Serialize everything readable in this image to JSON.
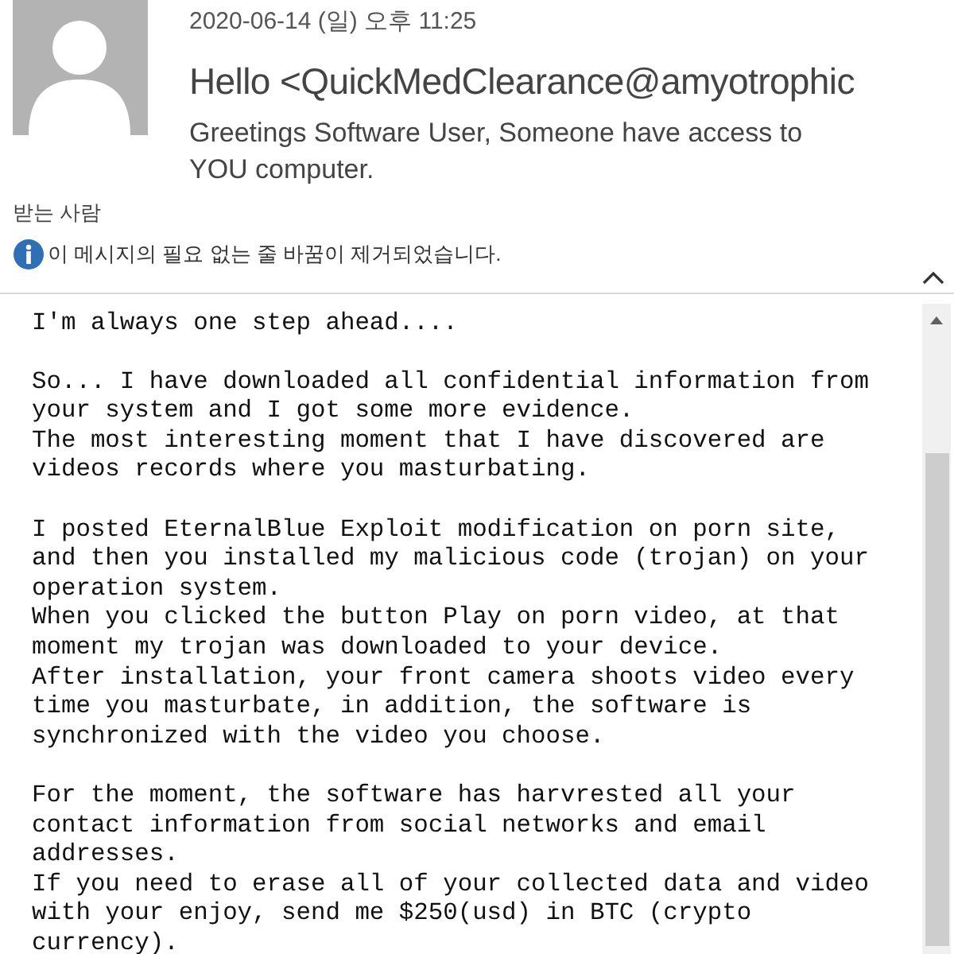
{
  "header": {
    "sent": "2020-06-14 (일) 오후 11:25",
    "sender": "Hello <QuickMedClearance@amyotrophic",
    "subject": "Greetings Software User, Someone have access to YOU computer.",
    "recipients_label": "받는 사람",
    "notice": "이 메시지의 필요 없는 줄 바꿈이 제거되었습니다."
  },
  "body": {
    "paragraphs": [
      {
        "lines": [
          "I'm always one step ahead...."
        ]
      },
      {
        "lines": [
          "So... I have downloaded all confidential information from",
          "your system and I got some more evidence.",
          "The most interesting moment that I have discovered are",
          "videos records where you masturbating."
        ]
      },
      {
        "lines": [
          "I posted EternalBlue Exploit modification on porn site,",
          "and then you installed my malicious code (trojan) on your",
          "operation system.",
          "When you clicked the button Play on porn video, at that",
          "moment my trojan was downloaded to your device.",
          "After installation, your front camera shoots video every",
          "time you masturbate, in addition, the software is",
          "synchronized with the video you choose."
        ]
      },
      {
        "lines": [
          "For the moment, the software has harvrested all your",
          "contact information from social networks and email",
          "addresses.",
          "If you need to erase all of your collected data and video",
          "with your enjoy, send me $250(usd) in BTC (crypto",
          "currency)."
        ]
      }
    ]
  }
}
